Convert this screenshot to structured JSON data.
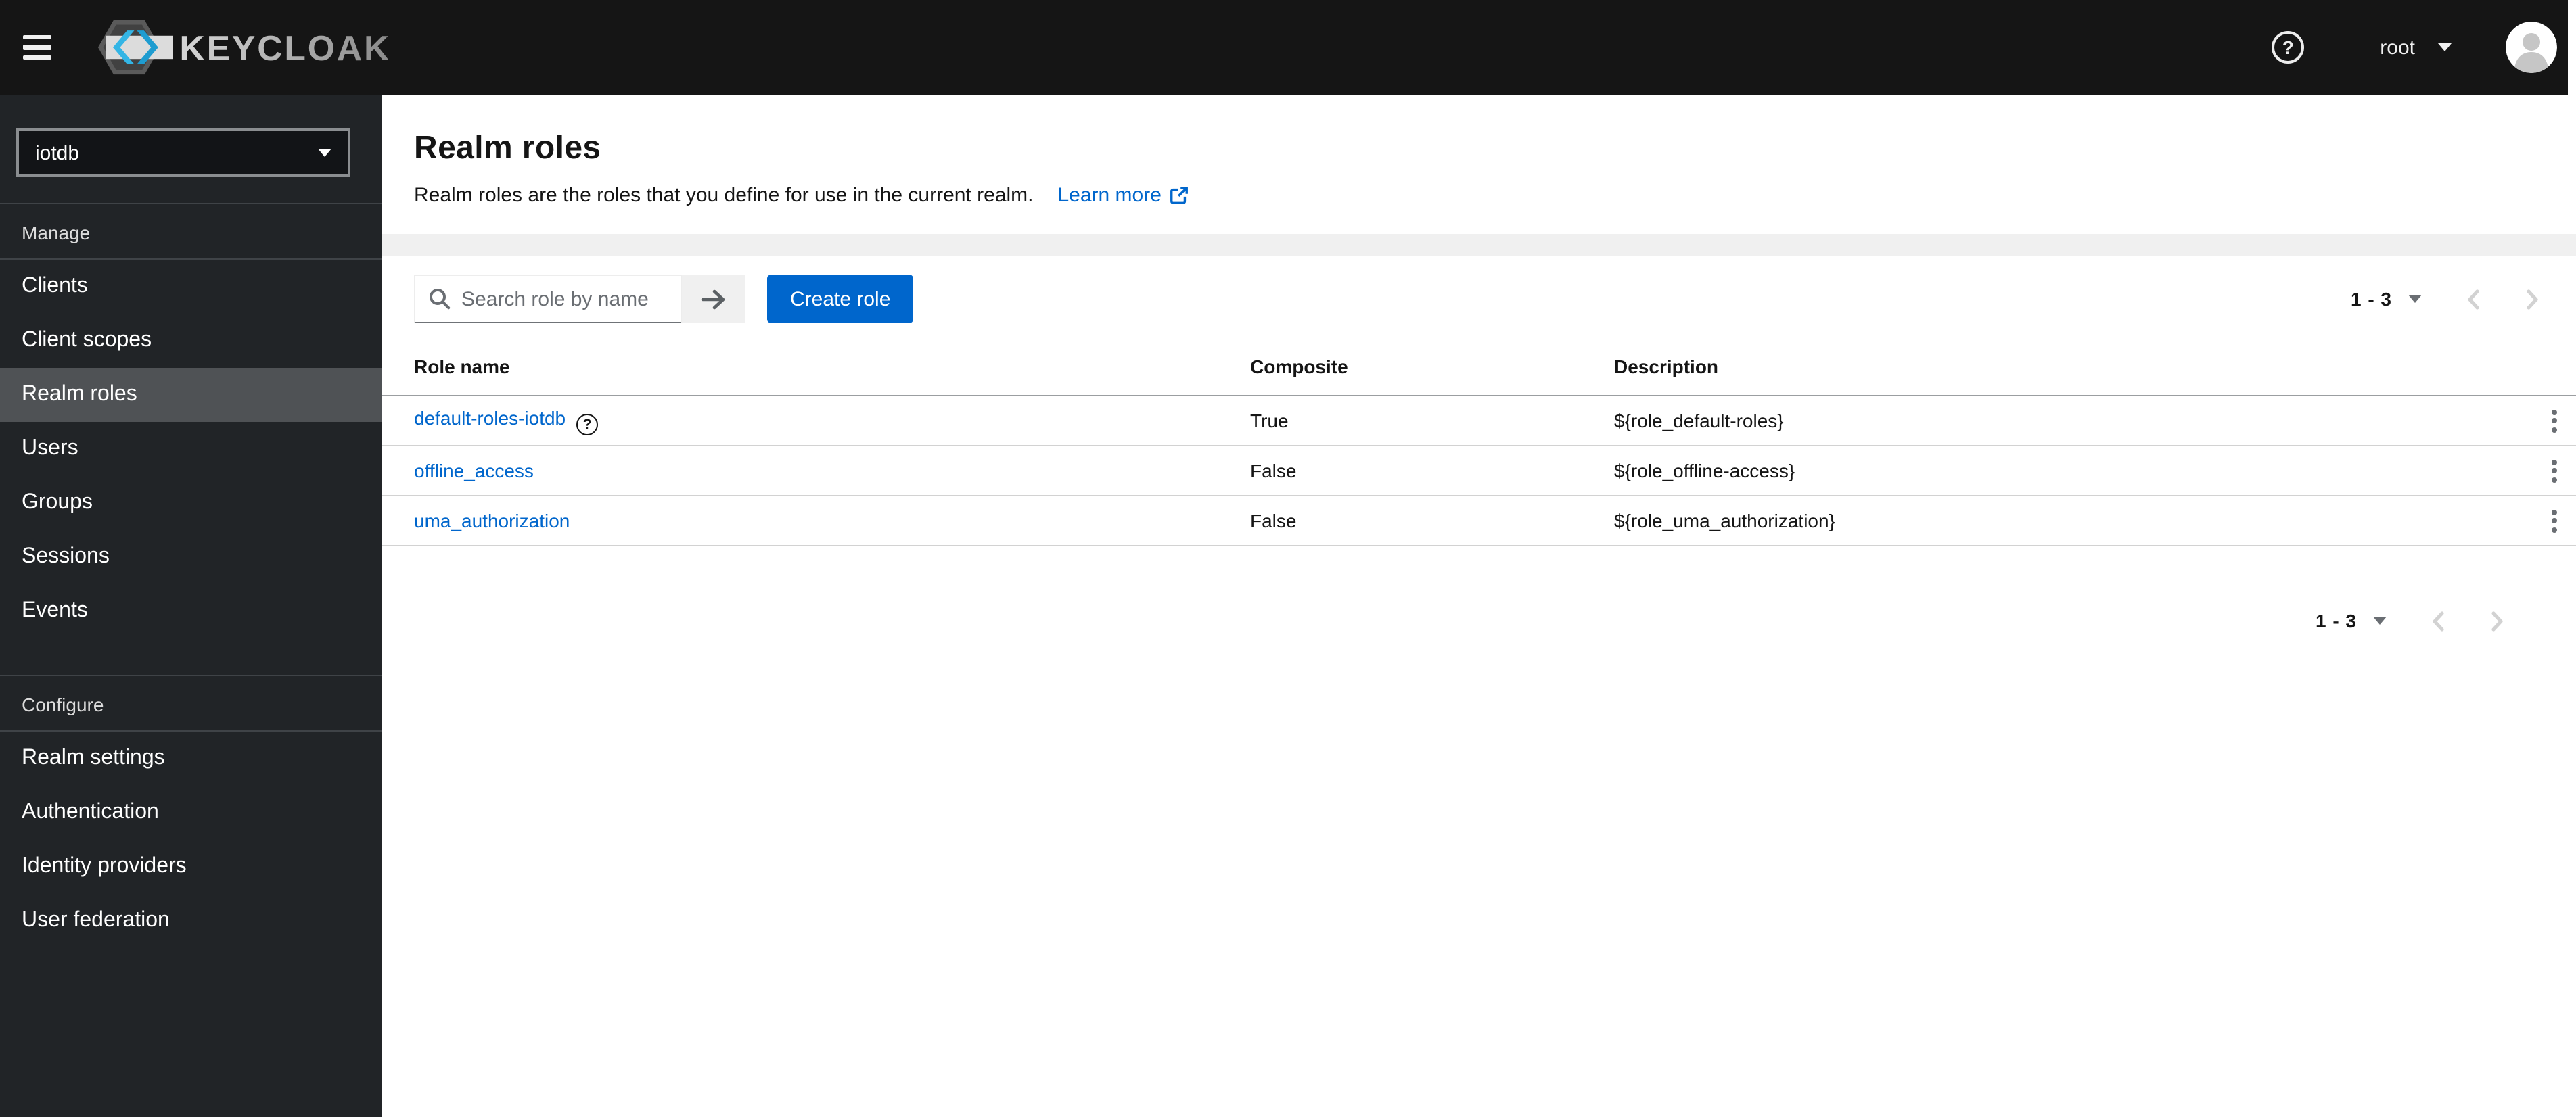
{
  "colors": {
    "primary": "#0066cc",
    "link": "#0066cc",
    "masthead_bg": "#151515",
    "sidebar_bg": "#212427",
    "selected_nav_bg": "#4f5255",
    "gray_band": "#f0f0f0"
  },
  "icons": {
    "hamburger": "menu-bars",
    "help": "?",
    "row_help": "?",
    "caret_down": "▾",
    "search": "magnifier",
    "arrow_right": "→",
    "external_link": "↗",
    "kebab": "⋮",
    "chevron_left": "‹",
    "chevron_right": "›"
  },
  "masthead": {
    "brand": "KEYCLOAK",
    "username": "root"
  },
  "sidebar": {
    "realm": "iotdb",
    "sections": [
      {
        "label": "Manage",
        "items": [
          {
            "label": "Clients"
          },
          {
            "label": "Client scopes"
          },
          {
            "label": "Realm roles",
            "selected": true
          },
          {
            "label": "Users"
          },
          {
            "label": "Groups"
          },
          {
            "label": "Sessions"
          },
          {
            "label": "Events"
          }
        ]
      },
      {
        "label": "Configure",
        "items": [
          {
            "label": "Realm settings"
          },
          {
            "label": "Authentication"
          },
          {
            "label": "Identity providers"
          },
          {
            "label": "User federation"
          }
        ]
      }
    ]
  },
  "page": {
    "title": "Realm roles",
    "subtitle": "Realm roles are the roles that you define for use in the current realm.",
    "learn_more": "Learn more",
    "toolbar": {
      "search_placeholder": "Search role by name",
      "create_button": "Create role"
    },
    "pagination_top": {
      "range": "1 - 3"
    },
    "pagination_bottom": {
      "range": "1 - 3"
    },
    "table": {
      "headers": {
        "name": "Role name",
        "composite": "Composite",
        "description": "Description"
      },
      "rows": [
        {
          "name": "default-roles-iotdb",
          "composite": "True",
          "description": "${role_default-roles}"
        },
        {
          "name": "offline_access",
          "composite": "False",
          "description": "${role_offline-access}"
        },
        {
          "name": "uma_authorization",
          "composite": "False",
          "description": "${role_uma_authorization}"
        }
      ]
    }
  }
}
